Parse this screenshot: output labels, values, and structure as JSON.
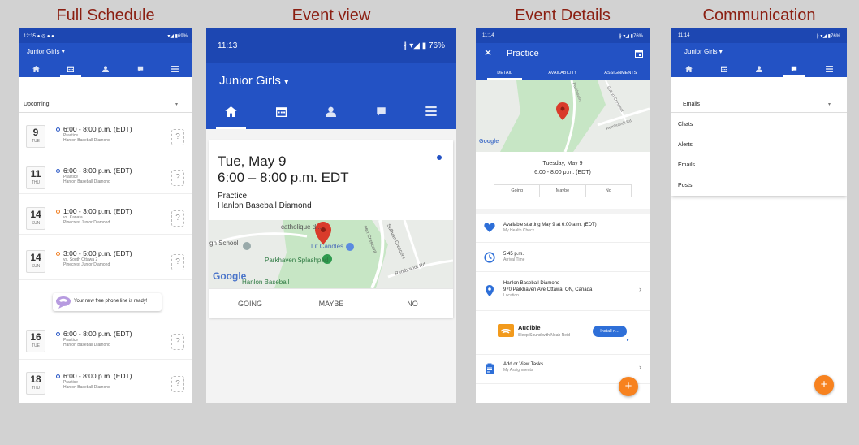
{
  "titles": {
    "full_schedule": "Full Schedule",
    "event_view": "Event view",
    "event_details": "Event Details",
    "communication": "Communication"
  },
  "colors": {
    "brand": "#2352c4",
    "accent": "#f7821f",
    "title": "#8b1f12"
  },
  "phone1": {
    "status": {
      "time": "12:35",
      "battery": "69%"
    },
    "team": "Junior Girls",
    "filter": "Upcoming",
    "events": [
      {
        "day": "9",
        "dow": "TUE",
        "time": "6:00 - 8:00 p.m. (EDT)",
        "type": "Practice",
        "loc": "Hanlon Baseball Diamond",
        "q": "?"
      },
      {
        "day": "11",
        "dow": "THU",
        "time": "6:00 - 8:00 p.m. (EDT)",
        "type": "Practice",
        "loc": "Hanlon Baseball Diamond",
        "q": "?"
      },
      {
        "day": "14",
        "dow": "SUN",
        "time": "1:00 - 3:00 p.m. (EDT)",
        "type": "vs. Kanata",
        "loc": "Pinecrest Junior Diamond",
        "q": "?"
      },
      {
        "day": "14",
        "dow": "SUN",
        "time": "3:00 - 5:00 p.m. (EDT)",
        "type": "vs. South Ottawa 2",
        "loc": "Pinecrest Junior Diamond",
        "q": "?"
      },
      {
        "day": "16",
        "dow": "TUE",
        "time": "6:00 - 8:00 p.m. (EDT)",
        "type": "Practice",
        "loc": "Hanlon Baseball Diamond",
        "q": "?"
      },
      {
        "day": "18",
        "dow": "THU",
        "time": "6:00 - 8:00 p.m. (EDT)",
        "type": "Practice",
        "loc": "Hanlon Baseball Diamond",
        "q": "?"
      }
    ],
    "promo": "Your new free phone line is ready!"
  },
  "phone2": {
    "status": {
      "time": "11:13",
      "battery": "76%"
    },
    "team": "Junior Girls",
    "date": "Tue, May 9",
    "time": "6:00 – 8:00 p.m. EDT",
    "type": "Practice",
    "loc": "Hanlon Baseball Diamond",
    "map": {
      "school": "gh School",
      "church": "catholique d...",
      "candles": "Lit Candles",
      "splash": "Parkhaven Splashpad",
      "baseball": "Hanlon Baseball",
      "crescent": "den Crescent",
      "street1": "Sullivan Crescent",
      "street2": "Rembrandt Rd",
      "google": "Google"
    },
    "rsvp": [
      "GOING",
      "MAYBE",
      "NO"
    ]
  },
  "phone3": {
    "status": {
      "time": "11:14",
      "battery": "76%"
    },
    "title": "Practice",
    "tabs": [
      "DETAIL",
      "AVAILABILITY",
      "ASSIGNMENTS"
    ],
    "map": {
      "google": "Google",
      "street1": "Sutton Crescent",
      "street2": "Rembrandt Rd",
      "street3": "Parkhaven"
    },
    "date": "Tuesday, May 9",
    "time": "6:00 - 8:00 p.m. (EDT)",
    "rsvp": [
      "Going",
      "Maybe",
      "No"
    ],
    "details": [
      {
        "a": "Available starting May 9 at 6:00 a.m. (EDT)",
        "b": "My Health Check"
      },
      {
        "a": "5:45 p.m.",
        "b": "Arrival Time"
      },
      {
        "a": "Hanlon Baseball Diamond",
        "a2": "970 Parkhaven Ave Ottawa, ON, Canada",
        "b": "Location"
      },
      {
        "a": "Add or View Tasks",
        "b": "My Assignments"
      }
    ],
    "ad": {
      "title": "Audible",
      "sub": "Sleep Sound with Noah Reid",
      "btn": "Install n..."
    }
  },
  "phone4": {
    "status": {
      "time": "11:14",
      "battery": "76%"
    },
    "team": "Junior Girls",
    "filter": "Emails",
    "menu": [
      "Chats",
      "Alerts",
      "Emails",
      "Posts"
    ]
  }
}
